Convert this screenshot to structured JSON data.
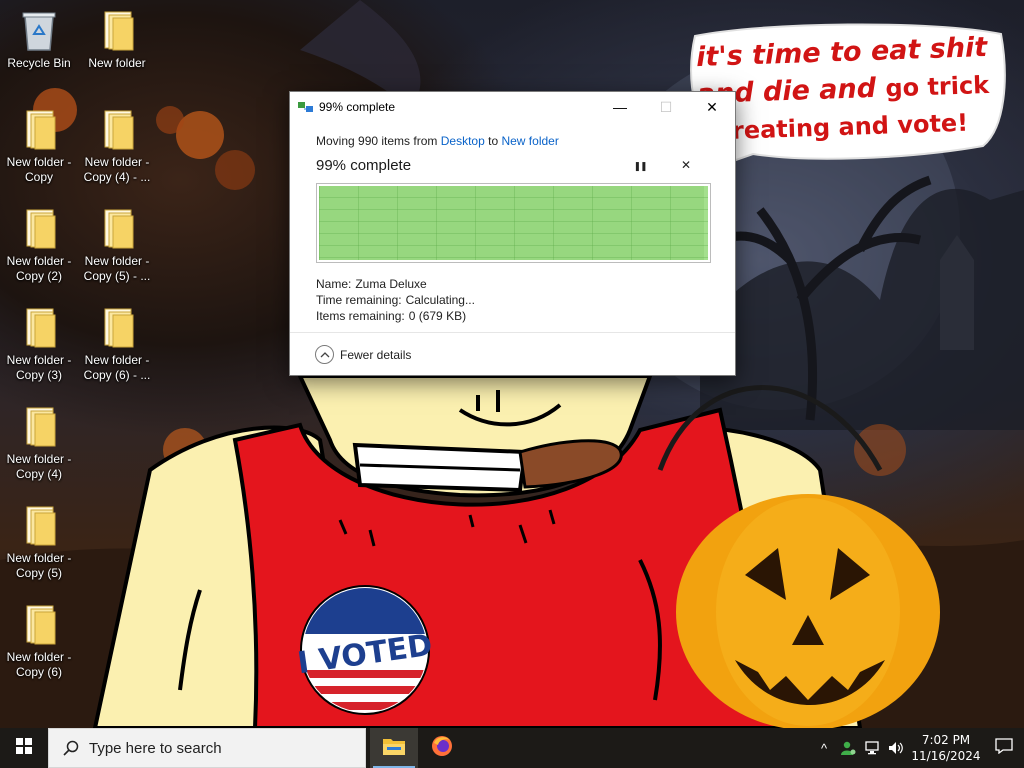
{
  "desktop": {
    "icons": [
      {
        "label": "Recycle Bin"
      },
      {
        "label": "New folder"
      },
      {
        "label": "New folder - Copy"
      },
      {
        "label": "New folder - Copy (4) - ..."
      },
      {
        "label": "New folder - Copy (2)"
      },
      {
        "label": "New folder - Copy (5) - ..."
      },
      {
        "label": "New folder - Copy (3)"
      },
      {
        "label": "New folder - Copy (6) - ..."
      },
      {
        "label": "New folder - Copy (4)"
      },
      {
        "label": "New folder - Copy (5)"
      },
      {
        "label": "New folder - Copy (6)"
      }
    ]
  },
  "wallpaper": {
    "speech_bubble": {
      "line1": "it's time to eat shit",
      "line2": "and die and",
      "line2b": "go trick",
      "line3": "treating and vote!"
    },
    "sticker_text": "I VOTED"
  },
  "dialog": {
    "title": "99% complete",
    "moving_prefix": "Moving 990 items from",
    "source": "Desktop",
    "to_word": "to",
    "destination": "New folder",
    "percent_text": "99% complete",
    "progress_fraction": 0.99,
    "pause_glyph": "❚❚",
    "cancel_glyph": "✕",
    "name_label": "Name:",
    "name_value": "Zuma Deluxe",
    "time_label": "Time remaining:",
    "time_value": "Calculating...",
    "items_label": "Items remaining:",
    "items_value": "0 (679 KB)",
    "footer_label": "Fewer details",
    "minimize_glyph": "—",
    "maximize_glyph": "☐",
    "close_glyph": "✕"
  },
  "taskbar": {
    "search_placeholder": "Type here to search",
    "clock_time": "7:02 PM",
    "clock_date": "11/16/2024",
    "tray_chevron": "^"
  },
  "colors": {
    "progress_green": "#a4e08d",
    "link_blue": "#0a63c9",
    "bubble_text_red": "#d11414"
  },
  "icons": [
    "recycle-bin-icon",
    "folder-icon",
    "copy-icon",
    "windows-start-icon",
    "search-icon",
    "file-explorer-icon",
    "firefox-icon",
    "people-icon",
    "network-icon",
    "volume-icon",
    "notification-icon"
  ]
}
